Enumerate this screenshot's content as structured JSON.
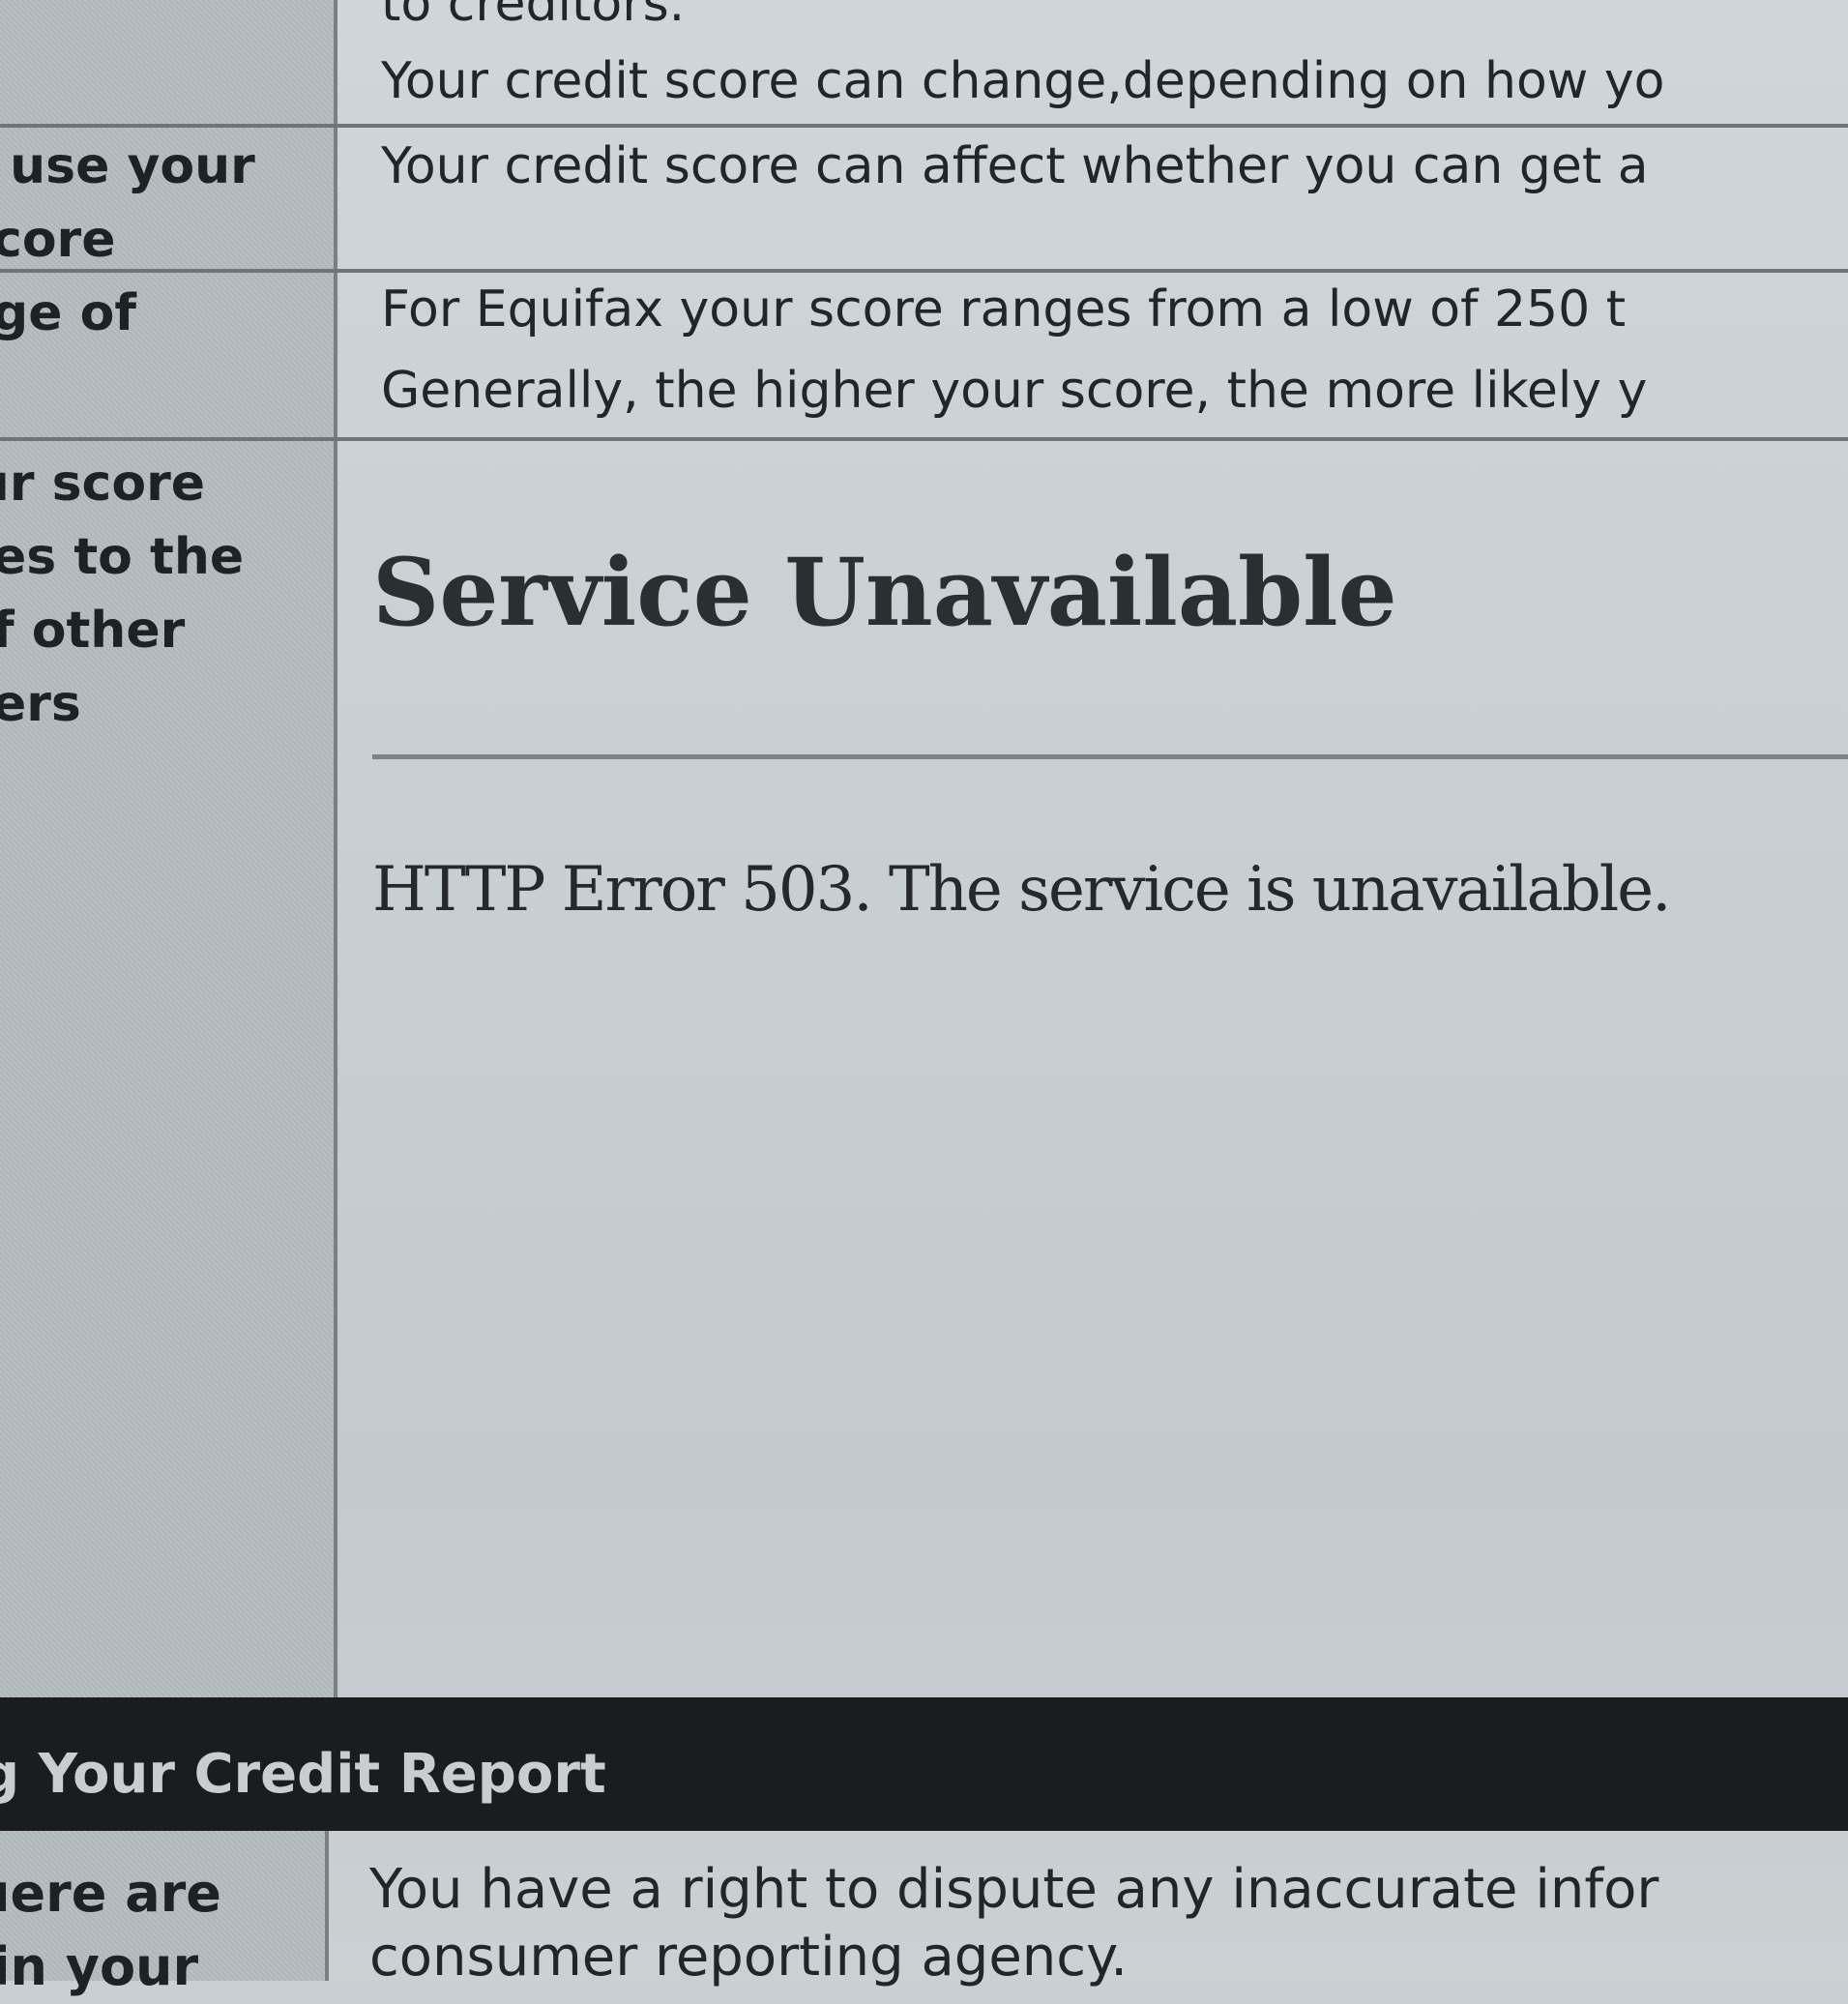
{
  "rows": [
    {
      "label": "",
      "text_lines": [
        "to creditors.",
        "Your credit score can change,depending on how yo"
      ]
    },
    {
      "label": " use your\ncore",
      "text_lines": [
        "Your credit score can affect whether you can get a"
      ]
    },
    {
      "label": "ge of",
      "text_lines": [
        "For Equifax your score ranges from a low of 250 t",
        "Generally, the higher your score, the more likely y"
      ]
    },
    {
      "label": "ır score\nes to the\nf other\ners",
      "text_lines": []
    }
  ],
  "error": {
    "title": "Service Unavailable",
    "message": "HTTP Error 503. The service is unavailable."
  },
  "section": {
    "title": "g Your Credit Report"
  },
  "bottom_row": {
    "label": "ıere are\nin your",
    "text_lines": [
      "You have a right to dispute any inaccurate infor",
      "consumer reporting agency."
    ]
  }
}
